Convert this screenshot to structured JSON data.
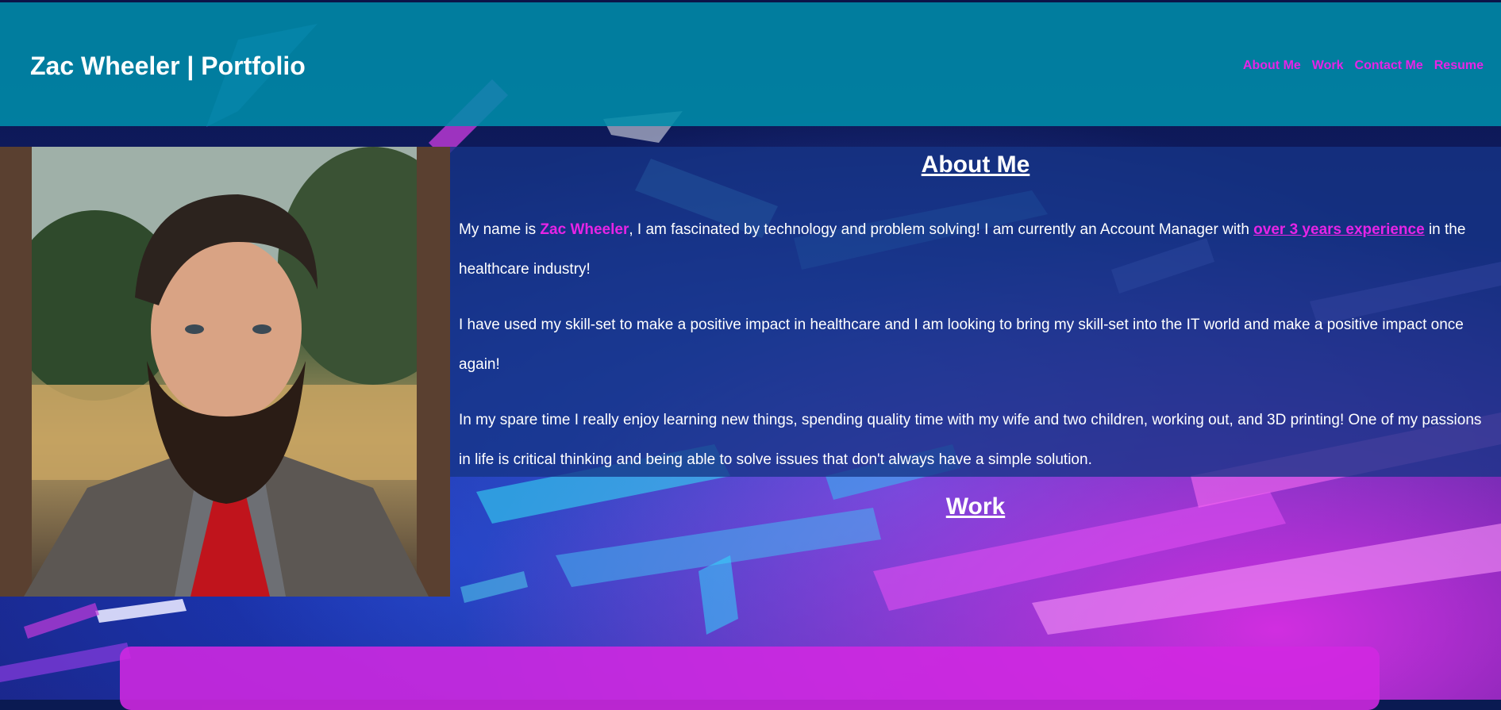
{
  "header": {
    "title": "Zac Wheeler | Portfolio",
    "nav": [
      {
        "label": "About Me"
      },
      {
        "label": "Work"
      },
      {
        "label": "Contact Me"
      },
      {
        "label": "Resume"
      }
    ]
  },
  "about": {
    "heading": "About Me",
    "p1": {
      "pre": "My name is ",
      "name": "Zac Wheeler",
      "mid": ", I am fascinated by technology and problem solving! I am currently an Account Manager with ",
      "link": "over 3 years experience",
      "post": " in the healthcare industry!"
    },
    "p2": "I have used my skill-set to make a positive impact in healthcare and I am looking to bring my skill-set into the IT world and make a positive impact once again!",
    "p3": "In my spare time I really enjoy learning new things, spending quality time with my wife and two children, working out, and 3D printing! One of my passions in life is critical thinking and being able to solve issues that don't always have a simple solution."
  },
  "work": {
    "heading": "Work"
  },
  "colors": {
    "accent": "#e624e6",
    "header_bg": "#008caa",
    "panel_bg": "#163487",
    "card_bg": "#d228e1"
  },
  "icons": {
    "portrait": "profile-photo"
  }
}
